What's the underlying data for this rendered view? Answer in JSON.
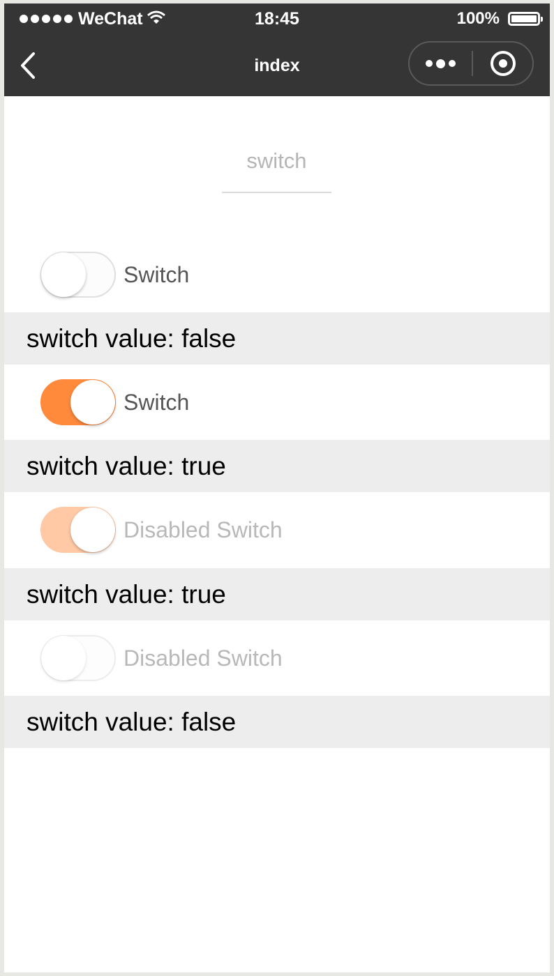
{
  "status_bar": {
    "carrier": "WeChat",
    "time": "18:45",
    "battery": "100%"
  },
  "nav": {
    "title": "index",
    "icons": {
      "back": "chevron-left-icon",
      "more": "more-dots-icon",
      "close": "target-circle-icon"
    }
  },
  "page": {
    "header": "switch"
  },
  "switches": [
    {
      "label": "Switch",
      "checked": false,
      "disabled": false,
      "value_text": "switch value: false"
    },
    {
      "label": "Switch",
      "checked": true,
      "disabled": false,
      "value_text": "switch value: true"
    },
    {
      "label": "Disabled Switch",
      "checked": true,
      "disabled": true,
      "value_text": "switch value: true"
    },
    {
      "label": "Disabled Switch",
      "checked": false,
      "disabled": true,
      "value_text": "switch value: false"
    }
  ],
  "colors": {
    "nav_background": "#353535",
    "switch_on": "#ff8a3c",
    "switch_disabled_on": "#ffc9a6",
    "value_bar": "#ededed"
  }
}
